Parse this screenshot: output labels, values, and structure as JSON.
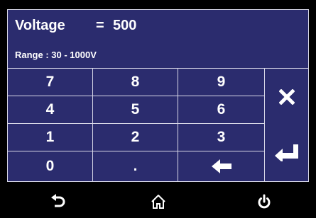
{
  "readout": {
    "parameter": "Voltage",
    "equals": "=",
    "value": "500",
    "range_label": "Range : 30 - 1000V"
  },
  "keypad": {
    "keys": [
      "7",
      "8",
      "9",
      "4",
      "5",
      "6",
      "1",
      "2",
      "3",
      "0",
      "."
    ]
  },
  "icons": {
    "backspace": "left-arrow-icon",
    "cancel": "close-icon",
    "enter": "enter-icon",
    "back": "back-arrow-icon",
    "home": "home-icon",
    "power": "power-icon"
  },
  "colors": {
    "panel_background": "#2b2c6e",
    "grid_lines": "#d8d8e8",
    "text": "#ffffff",
    "screen_background": "#000000"
  }
}
